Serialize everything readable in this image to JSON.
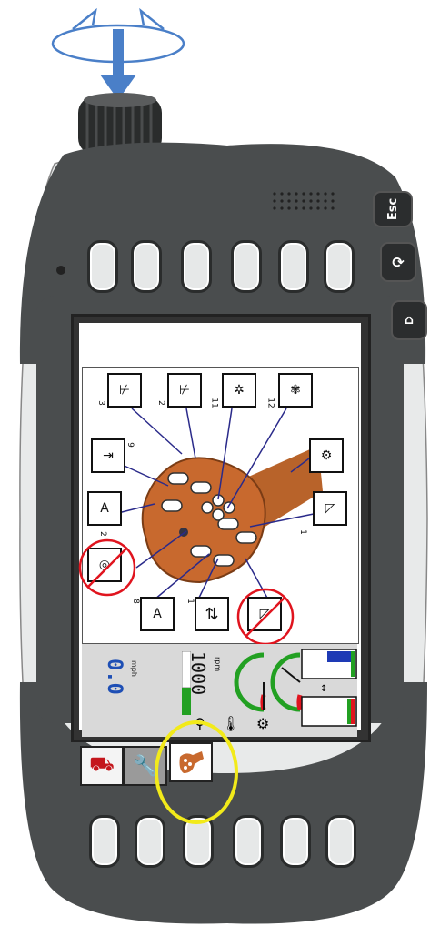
{
  "device": {
    "side_buttons": [
      {
        "label": "Esc",
        "icon": "esc-key"
      },
      {
        "label": "",
        "icon": "rotate-icon"
      },
      {
        "label": "",
        "icon": "home-icon"
      }
    ]
  },
  "diagram": {
    "callouts": [
      {
        "num": "3",
        "icon": "swath-left-icon"
      },
      {
        "num": "2",
        "icon": "swath-right-icon"
      },
      {
        "num": "11",
        "icon": "spread-icon"
      },
      {
        "num": "12",
        "icon": "pto-spread-icon"
      },
      {
        "num": "9",
        "icon": "section-narrow-icon"
      },
      {
        "num": "",
        "icon": "pto-gear-icon"
      },
      {
        "num": "2",
        "icon": "auto-swath-icon"
      },
      {
        "num": "1",
        "icon": "boom-fold-icon"
      },
      {
        "num": "",
        "icon": "steering-wheel-crossed-icon"
      },
      {
        "num": "8",
        "icon": "auto-spread-icon"
      },
      {
        "num": "1",
        "icon": "cycle-arrows-icon"
      },
      {
        "num": "",
        "icon": "boom-fold-crossed-icon"
      }
    ]
  },
  "status": {
    "speed_value": "0.0",
    "speed_unit": "mph",
    "rpm_value": "1000",
    "rpm_unit": "rpm"
  },
  "tabs": [
    {
      "icon": "tractor-icon"
    },
    {
      "icon": "wrench-icon"
    },
    {
      "icon": "joystick-icon"
    }
  ],
  "colors": {
    "housing": "#4a4d4e",
    "rim": "#e8eaea",
    "speed_blue": "#1e4fb5",
    "highlight_red": "#e0141e",
    "highlight_yellow": "#f2ea1a",
    "joystick_orange": "#c8692e",
    "arrow_blue": "#4a7fc8"
  }
}
